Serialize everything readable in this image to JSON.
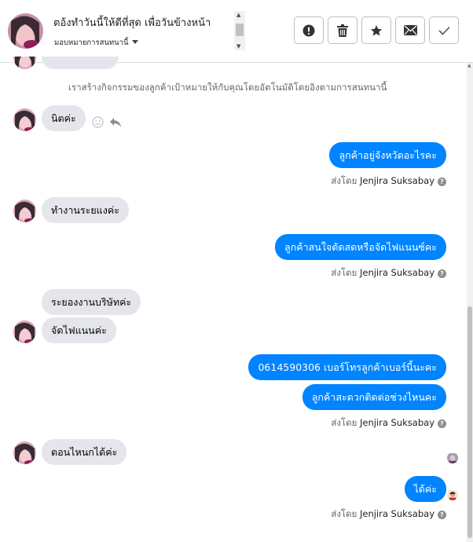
{
  "header": {
    "title": "ตอ้งทำวันนี้ให้ดีที่สุด เพื่อวันข้างหน้า",
    "subtitle": "มอบหมายการสนทนานี้",
    "buttons": {
      "report_icon": "exclamation-circle-icon",
      "delete_icon": "trash-icon",
      "star_icon": "star-icon",
      "mail_icon": "envelope-icon",
      "done_icon": "checkmark-icon"
    }
  },
  "system_note": "เราสร้างกิจกรรมของลูกค้าเป้าหมายให้กับคุณโดยอัตโนมัติโดยอิงตามการสนทนานี้",
  "sent_by_label": "ส่งโดย",
  "agent_name": "Jenjira Suksabay",
  "messages": {
    "m1": "นิตค่ะ",
    "m2": "ลูกค้าอยู่จังหวัดอะไรคะ",
    "m3": "ทำงานระยแงค่ะ",
    "m4": "ลูกค้าสนใจตัดสดหรือจัดไฟแนนซ์คะ",
    "m5": "ระยองงานบริษัทค่ะ",
    "m6": "จัดไฟแนนค่ะ",
    "m7": "0614590306 เบอร์โทรลูกค้าเบอร์นี้นะคะ",
    "m8": "ลูกค้าสะดวกติดต่อช่วงไหนคะ",
    "m9": "ตอนไหนกได้ค่ะ",
    "m10": "ได้ค่ะ"
  },
  "colors": {
    "outgoing_bubble": "#0084ff",
    "incoming_bubble": "#e4e6eb",
    "muted_text": "#65676b"
  }
}
